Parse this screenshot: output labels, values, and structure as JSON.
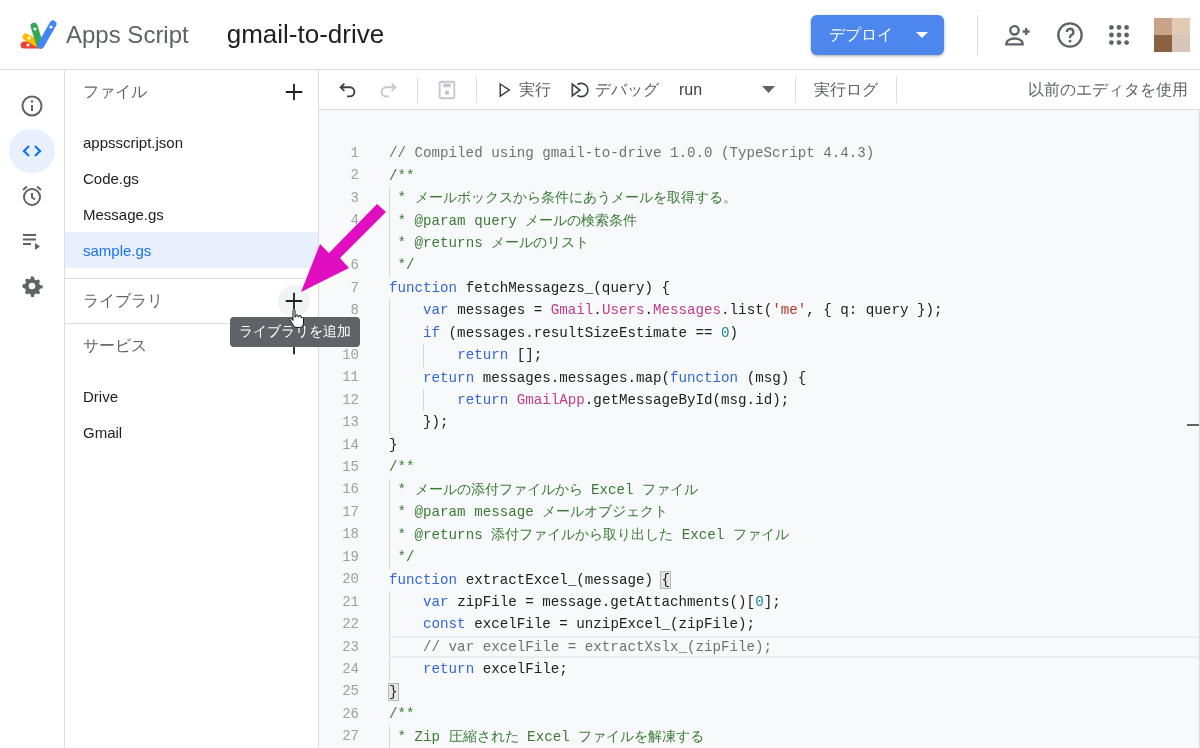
{
  "app": {
    "name": "Apps Script"
  },
  "project": {
    "title": "gmail-to-drive"
  },
  "deploy_button": {
    "label": "デプロイ"
  },
  "rail": [
    {
      "kind": "info",
      "selected": false
    },
    {
      "kind": "code",
      "selected": true
    },
    {
      "kind": "triggers",
      "selected": false
    },
    {
      "kind": "executions",
      "selected": false
    },
    {
      "kind": "settings",
      "selected": false
    }
  ],
  "sidebar": {
    "sections": [
      {
        "title": "ファイル",
        "add_hovered": false,
        "items": [
          {
            "label": "appsscript.json",
            "selected": false
          },
          {
            "label": "Code.gs",
            "selected": false
          },
          {
            "label": "Message.gs",
            "selected": false
          },
          {
            "label": "sample.gs",
            "selected": true
          }
        ]
      },
      {
        "title": "ライブラリ",
        "add_hovered": true,
        "tooltip": "ライブラリを追加"
      },
      {
        "title": "サービス",
        "add_hovered": false,
        "items": [
          {
            "label": "Drive",
            "selected": false
          },
          {
            "label": "Gmail",
            "selected": false
          }
        ]
      }
    ]
  },
  "toolbar": {
    "undo": {
      "disabled": false
    },
    "redo": {
      "disabled": true
    },
    "save": {
      "disabled": true
    },
    "run_label": "実行",
    "debug_label": "デバッグ",
    "function": "run",
    "log_label": "実行ログ",
    "legacy_label": "以前のエディタを使用"
  },
  "editor": {
    "lines": [
      {
        "number": "1",
        "current": false,
        "tokens": [
          {
            "kind": "comment",
            "text": "// Compiled using gmail-to-drive 1.0.0 (TypeScript 4.4.3)"
          }
        ]
      },
      {
        "number": "2",
        "current": false,
        "tokens": [
          {
            "kind": "doc",
            "text": "/**"
          }
        ]
      },
      {
        "number": "3",
        "current": false,
        "tokens": [
          {
            "kind": "doc",
            "text": " * メールボックスから条件にあうメールを取得する。"
          }
        ]
      },
      {
        "number": "4",
        "current": false,
        "tokens": [
          {
            "kind": "doc",
            "text": " * @param query メールの検索条件"
          }
        ]
      },
      {
        "current": false,
        "tokens": [
          {
            "kind": "doc",
            "text": " * @returns メールのリスト"
          }
        ]
      },
      {
        "number": "6",
        "current": false,
        "tokens": [
          {
            "kind": "doc",
            "text": " */"
          }
        ]
      },
      {
        "number": "7",
        "current": false,
        "tokens": [
          {
            "kind": "kw",
            "text": "function"
          },
          {
            "kind": "plain",
            "text": " fetchMessagezs_(query) {"
          }
        ]
      },
      {
        "number": "8",
        "current": false,
        "tokens": [
          {
            "kind": "kw",
            "text": "    var"
          },
          {
            "kind": "plain",
            "text": " messages = "
          },
          {
            "kind": "api",
            "text": "Gmail"
          },
          {
            "kind": "plain",
            "text": "."
          },
          {
            "kind": "api",
            "text": "Users"
          },
          {
            "kind": "plain",
            "text": "."
          },
          {
            "kind": "api",
            "text": "Messages"
          },
          {
            "kind": "plain",
            "text": ".list("
          },
          {
            "kind": "str",
            "text": "'me'"
          },
          {
            "kind": "plain",
            "text": ", { q: query });"
          }
        ]
      },
      {
        "current": false,
        "tokens": [
          {
            "kind": "kw",
            "text": "    if"
          },
          {
            "kind": "plain",
            "text": " (messages.resultSizeEstimate == "
          },
          {
            "kind": "num",
            "text": "0"
          },
          {
            "kind": "plain",
            "text": ")"
          }
        ]
      },
      {
        "number": "10",
        "current": false,
        "tokens": [
          {
            "kind": "kw",
            "text": "        return"
          },
          {
            "kind": "plain",
            "text": " [];"
          }
        ]
      },
      {
        "number": "11",
        "current": false,
        "tokens": [
          {
            "kind": "kw",
            "text": "    return"
          },
          {
            "kind": "plain",
            "text": " messages.messages.map("
          },
          {
            "kind": "kw",
            "text": "function"
          },
          {
            "kind": "plain",
            "text": " (msg) {"
          }
        ]
      },
      {
        "number": "12",
        "current": false,
        "tokens": [
          {
            "kind": "kw",
            "text": "        return"
          },
          {
            "kind": "api",
            "text": " GmailApp"
          },
          {
            "kind": "plain",
            "text": ".getMessageById(msg.id);"
          }
        ]
      },
      {
        "number": "13",
        "current": false,
        "tokens": [
          {
            "kind": "plain",
            "text": "    });"
          }
        ]
      },
      {
        "number": "14",
        "current": false,
        "tokens": [
          {
            "kind": "plain",
            "text": "}"
          }
        ]
      },
      {
        "number": "15",
        "current": false,
        "tokens": [
          {
            "kind": "doc",
            "text": "/**"
          }
        ]
      },
      {
        "number": "16",
        "current": false,
        "tokens": [
          {
            "kind": "doc",
            "text": " * メールの添付ファイルから Excel ファイル"
          }
        ]
      },
      {
        "number": "17",
        "current": false,
        "tokens": [
          {
            "kind": "doc",
            "text": " * @param message メールオブジェクト"
          }
        ]
      },
      {
        "number": "18",
        "current": false,
        "tokens": [
          {
            "kind": "doc",
            "text": " * @returns 添付ファイルから取り出した Excel ファイル"
          }
        ]
      },
      {
        "number": "19",
        "current": false,
        "tokens": [
          {
            "kind": "doc",
            "text": " */"
          }
        ]
      },
      {
        "number": "20",
        "current": false,
        "tokens": [
          {
            "kind": "kw",
            "text": "function"
          },
          {
            "kind": "plain",
            "text": " extractExcel_(message) "
          },
          {
            "kind": "match",
            "text": "{"
          }
        ]
      },
      {
        "number": "21",
        "current": false,
        "tokens": [
          {
            "kind": "kw",
            "text": "    var"
          },
          {
            "kind": "plain",
            "text": " zipFile = message.getAttachments()["
          },
          {
            "kind": "num",
            "text": "0"
          },
          {
            "kind": "plain",
            "text": "];"
          }
        ]
      },
      {
        "number": "22",
        "current": false,
        "tokens": [
          {
            "kind": "kw",
            "text": "    const"
          },
          {
            "kind": "plain",
            "text": " excelFile = unzipExcel_(zipFile);"
          }
        ]
      },
      {
        "number": "23",
        "current": true,
        "tokens": [
          {
            "kind": "comment",
            "text": "    // var excelFile = extractXslx_(zipFile);"
          }
        ]
      },
      {
        "number": "24",
        "current": false,
        "tokens": [
          {
            "kind": "kw",
            "text": "    return"
          },
          {
            "kind": "plain",
            "text": " excelFile;"
          }
        ]
      },
      {
        "number": "25",
        "current": false,
        "tokens": [
          {
            "kind": "match",
            "text": "}"
          }
        ]
      },
      {
        "number": "26",
        "current": false,
        "tokens": [
          {
            "kind": "doc",
            "text": "/**"
          }
        ]
      },
      {
        "number": "27",
        "current": false,
        "tokens": [
          {
            "kind": "doc",
            "text": " * Zip 圧縮された Excel ファイルを解凍する"
          }
        ]
      }
    ]
  }
}
